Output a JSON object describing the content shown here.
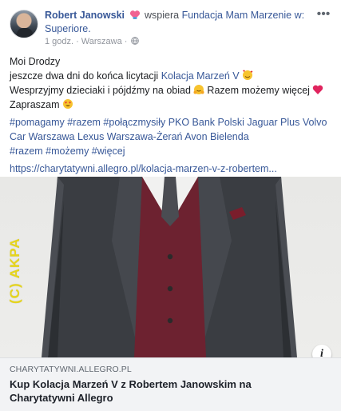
{
  "header": {
    "author": "Robert Janowski",
    "action_text": "wspiera",
    "page_name": "Fundacja Mam Marzenie w: Superiore.",
    "time": "1 godz.",
    "separator": "·",
    "location": "Warszawa",
    "separator2": "·",
    "more_label": "•••"
  },
  "post": {
    "line1": "Moi Drodzy",
    "line2_text": "jeszcze dwa dni do końca licytacji ",
    "line2_link": "Kolacja Marzeń V",
    "line3": "Wesprzyjmy dzieciaki i pójdźmy na obiad",
    "line3b": " Razem możemy więcej",
    "line4": "Zapraszam",
    "tags_line1": "#pomagamy #razem #połączmysiły PKO Bank Polski Jaguar Plus Volvo",
    "tags_line2": "Car Warszawa Lexus Warszawa-Żerań Avon Bielenda",
    "tags_line3": "#razem #możemy #więcej",
    "link": "https://charytatywni.allegro.pl/kolacja-marzen-v-z-robertem..."
  },
  "photo": {
    "watermark": "(C) AKPA"
  },
  "card": {
    "domain": "CHARYTATYWNI.ALLEGRO.PL",
    "title": "Kup Kolacja Marzeń V z Robertem Janowskim na Charytatywni Allegro",
    "info_label": "i"
  },
  "colors": {
    "link_blue": "#385898",
    "secondary_gray": "#90949c",
    "card_bg": "#f2f3f5"
  }
}
